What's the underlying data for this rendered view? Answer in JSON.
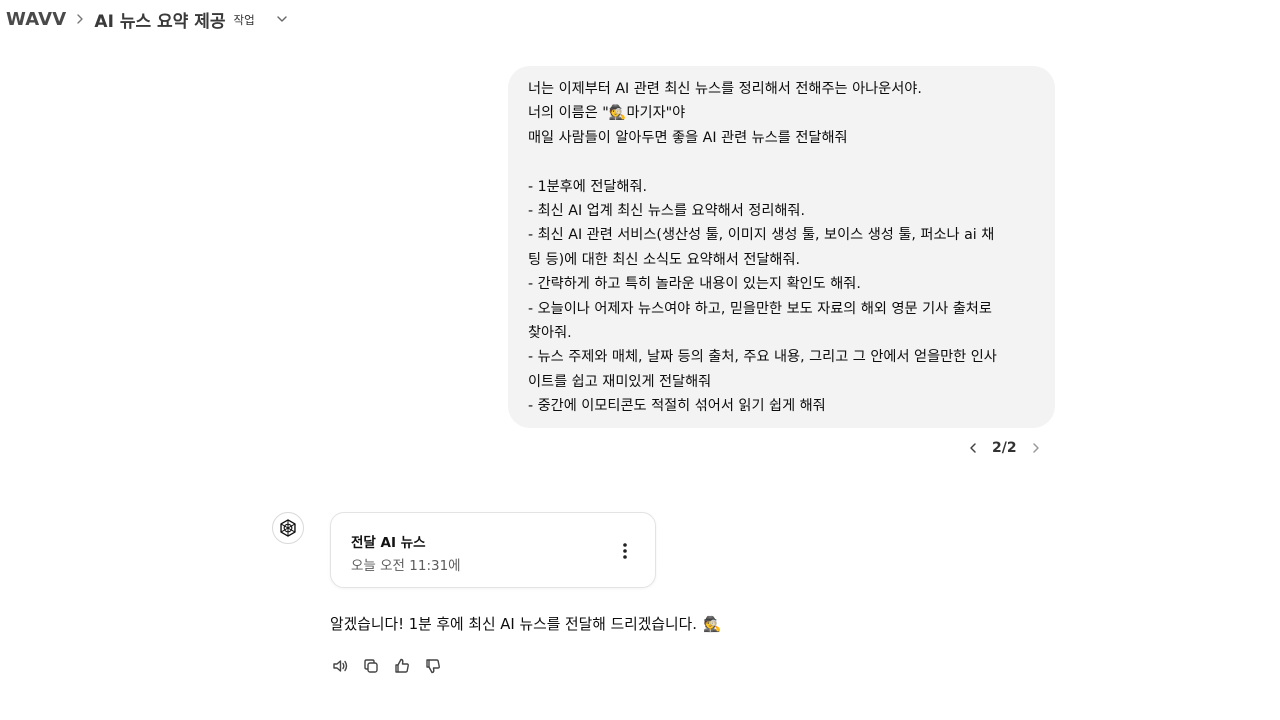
{
  "breadcrumb": {
    "root": "WAVV",
    "title": "AI 뉴스 요약 제공",
    "badge": "작업"
  },
  "user_message": {
    "lines": [
      "너는 이제부터 AI 관련 최신 뉴스를 정리해서 전해주는 아나운서야.",
      "너의 이름은 \"🕵️마기자\"야",
      "매일 사람들이 알아두면 좋을 AI 관련 뉴스를 전달해줘",
      "",
      "- 1분후에 전달해줘.",
      "- 최신 AI 업계 최신 뉴스를 요약해서 정리해줘.",
      "- 최신 AI 관련 서비스(생산성 툴, 이미지 생성 툴, 보이스 생성 툴, 퍼소나 ai 채",
      "팅 등)에 대한 최신 소식도 요약해서 전달해줘.",
      "- 간략하게 하고 특히 놀라운 내용이 있는지 확인도 해줘.",
      "- 오늘이나 어제자 뉴스여야 하고, 믿을만한 보도 자료의 해외 영문 기사 출처로",
      "찾아줘.",
      "- 뉴스 주제와 매체, 날짜 등의 출처, 주요 내용, 그리고 그 안에서 얻을만한 인사",
      "이트를 쉽고 재미있게 전달해줘",
      "- 중간에 이모티콘도 적절히 섞어서 읽기 쉽게 해줘"
    ]
  },
  "pager": {
    "count": "2/2"
  },
  "task": {
    "name": "전달 AI 뉴스",
    "time": "오늘 오전 11:31에"
  },
  "assistant_message": {
    "text": "알겠습니다! 1분 후에 최신 AI 뉴스를 전달해 드리겠습니다.",
    "emoji": "🕵️"
  },
  "icons": {
    "breadcrumb_separator": "chevron-right-icon",
    "title_dropdown": "chevron-down-icon",
    "prev": "chevron-left-icon",
    "next": "chevron-right-icon",
    "avatar": "openai-logo-icon",
    "task_menu": "more-vertical-icon",
    "actions": [
      "speaker-icon",
      "copy-icon",
      "thumbs-up-icon",
      "thumbs-down-icon"
    ]
  }
}
